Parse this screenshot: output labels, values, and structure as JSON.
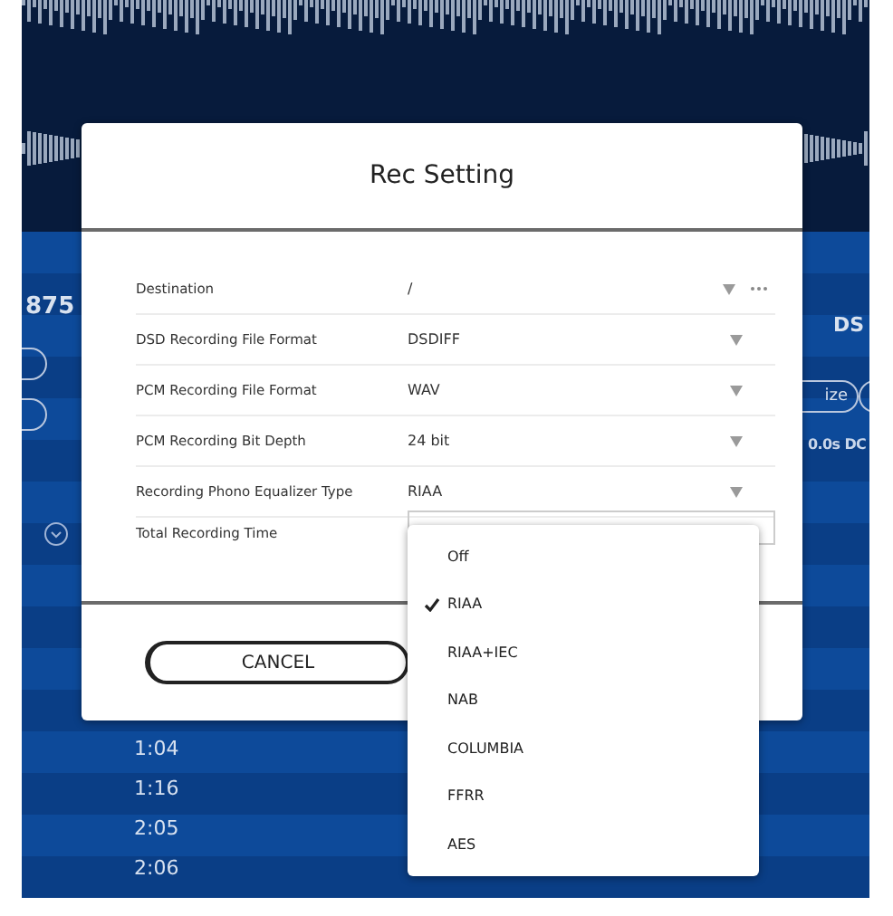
{
  "background": {
    "left_reading": "875",
    "right_label": "DS",
    "button_fragment": "ize",
    "readout": "0.0s DC",
    "times": [
      "1:04",
      "1:16",
      "2:05",
      "2:06"
    ]
  },
  "dialog": {
    "title": "Rec Setting",
    "settings": [
      {
        "label": "Destination",
        "value": "/",
        "kind": "path"
      },
      {
        "label": "DSD Recording File Format",
        "value": "DSDIFF",
        "kind": "select"
      },
      {
        "label": "PCM Recording File Format",
        "value": "WAV",
        "kind": "select"
      },
      {
        "label": "PCM Recording Bit Depth",
        "value": "24 bit",
        "kind": "select"
      },
      {
        "label": "Recording Phono Equalizer Type",
        "value": "RIAA",
        "kind": "select"
      },
      {
        "label": "Total Recording Time",
        "kind": "field"
      }
    ],
    "buttons": [
      {
        "label": "CANCEL"
      }
    ]
  },
  "menu": {
    "items": [
      {
        "label": "Off",
        "selected": false
      },
      {
        "label": "RIAA",
        "selected": true
      },
      {
        "label": "RIAA+IEC",
        "selected": false
      },
      {
        "label": "NAB",
        "selected": false
      },
      {
        "label": "COLUMBIA",
        "selected": false
      },
      {
        "label": "FFRR",
        "selected": false
      },
      {
        "label": "AES",
        "selected": false
      }
    ]
  }
}
